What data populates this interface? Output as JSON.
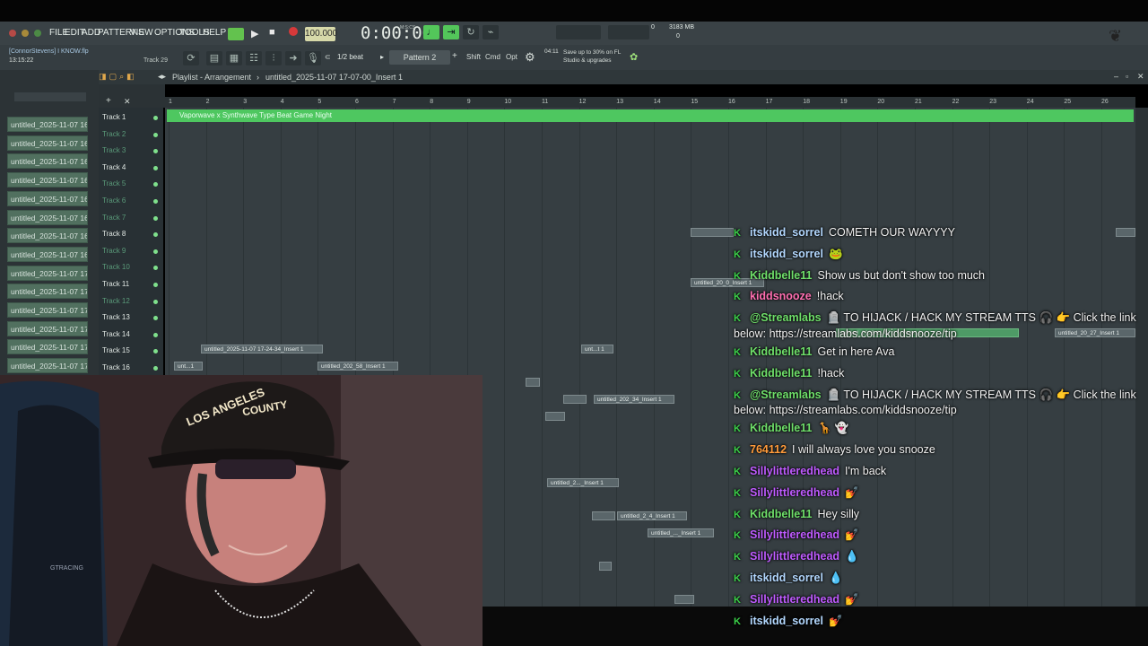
{
  "menu": [
    "FILE",
    "EDIT",
    "ADD",
    "PATTERNS",
    "VIEW",
    "OPTIONS",
    "TOOLS",
    "HELP"
  ],
  "project": {
    "user_file": "[ConnorStevens] I KNOW.flp",
    "clock": "13:15:22",
    "track_label": "Track 29"
  },
  "transport": {
    "tempo": "100.000",
    "time": "0:00:00",
    "time_small": "M:S:CS",
    "cpu": "3183 MB",
    "cpu2": "0",
    "poly": "0"
  },
  "toolbar2": {
    "beat": "1/2 beat",
    "pattern": "Pattern 2",
    "shift": "Shift",
    "cmd": "Cmd",
    "opt": "Opt",
    "news_count": "04:11",
    "news": "Save up to 30% on FL Studio & upgrades"
  },
  "playlist": {
    "title": "Playlist - Arrangement",
    "breadcrumb": "untitled_2025-11-07 17-07-00_Insert 1"
  },
  "browser_items": [
    "untitled_2025-11-07 16-...",
    "untitled_2025-11-07 16-...",
    "untitled_2025-11-07 16-...",
    "untitled_2025-11-07 16-...",
    "untitled_2025-11-07 16 ...",
    "untitled_2025-11-07 16-...",
    "untitled_2025-11-07 16 ...",
    "untitled_2025-11-07 16-...",
    "untitled_2025-11-07 17-...",
    "untitled_2025-11-07 17-...",
    "untitled_2025-11-07 17-...",
    "untitled_2025-11-07 17-...",
    "untitled_2025-11-07 17-...",
    "untitled_2025-11-07 17-...",
    "untitled_2025-11-07 17-..."
  ],
  "tracks": [
    "Track 1",
    "Track 2",
    "Track 3",
    "Track 4",
    "Track 5",
    "Track 6",
    "Track 7",
    "Track 8",
    "Track 9",
    "Track 10",
    "Track 11",
    "Track 12",
    "Track 13",
    "Track 14",
    "Track 15",
    "Track 16"
  ],
  "ruler": [
    "1",
    "2",
    "3",
    "4",
    "5",
    "6",
    "7",
    "8",
    "9",
    "10",
    "11",
    "12",
    "13",
    "14",
    "15",
    "16",
    "17",
    "18",
    "19",
    "20",
    "21",
    "22",
    "23",
    "24",
    "25",
    "26"
  ],
  "song_clip": "Vaporwave x Synthwave Type Beat Game Night",
  "clips": {
    "c1": "untitled_2025-11-07 17-24-34_Insert 1",
    "c2": "unt...1",
    "c3": "untitled_202_58_Insert 1",
    "c4": "unt...t 1",
    "c5": "untitled_202_34_Insert 1",
    "c6": "untitled_2..._Insert 1",
    "c7": "untitled_2_4_Insert 1",
    "c8": "untitled_..._Insert 1",
    "c9": "untitled_20_0_Insert 1",
    "c10": "untitled_20_27_Insert 1",
    "c11": "untitled_2025-11-07 17_Insert 1"
  },
  "webcam": {
    "hat_line1": "LOS ANGELES",
    "hat_line2": "COUNTY",
    "chair_brand": "GTRACING"
  },
  "chat": [
    {
      "user": "itskidd_sorrel",
      "color": "grey",
      "msg": "COMETH OUR WAYYYY"
    },
    {
      "user": "itskidd_sorrel",
      "color": "grey",
      "msg": "🐸"
    },
    {
      "user": "Kiddbelle11",
      "color": "green",
      "msg": "Show us but don't show too much"
    },
    {
      "user": "kiddsnooze",
      "color": "pink",
      "msg": "!hack"
    },
    {
      "user": "@Streamlabs",
      "color": "green",
      "msg": "🪦 TO HIJACK / HACK MY STREAM TTS 🎧 👉 Click the link",
      "cont": "below: https://streamlabs.com/kiddsnooze/tip"
    },
    {
      "user": "Kiddbelle11",
      "color": "green",
      "msg": "Get in here Ava"
    },
    {
      "user": "Kiddbelle11",
      "color": "green",
      "msg": "!hack"
    },
    {
      "user": "@Streamlabs",
      "color": "green",
      "msg": "🪦 TO HIJACK / HACK MY STREAM TTS 🎧 👉 Click the link",
      "cont": "below: https://streamlabs.com/kiddsnooze/tip"
    },
    {
      "user": "Kiddbelle11",
      "color": "green",
      "msg": "🦒 👻"
    },
    {
      "user": "764112",
      "color": "orange",
      "msg": "I will always love you snooze"
    },
    {
      "user": "Sillylittleredhead",
      "color": "purple",
      "msg": "I'm back"
    },
    {
      "user": "Sillylittleredhead",
      "color": "purple",
      "msg": "💅"
    },
    {
      "user": "Kiddbelle11",
      "color": "green",
      "msg": "Hey silly"
    },
    {
      "user": "Sillylittleredhead",
      "color": "purple",
      "msg": "💅"
    },
    {
      "user": "Sillylittleredhead",
      "color": "purple",
      "msg": "💧"
    },
    {
      "user": "itskidd_sorrel",
      "color": "grey",
      "msg": "💧"
    },
    {
      "user": "Sillylittleredhead",
      "color": "purple",
      "msg": "💅"
    },
    {
      "user": "itskidd_sorrel",
      "color": "grey",
      "msg": "💅"
    }
  ],
  "colors": {
    "accent_green": "#53c65a",
    "chat_badge": "#3cd24a",
    "bg": "#363e42"
  }
}
